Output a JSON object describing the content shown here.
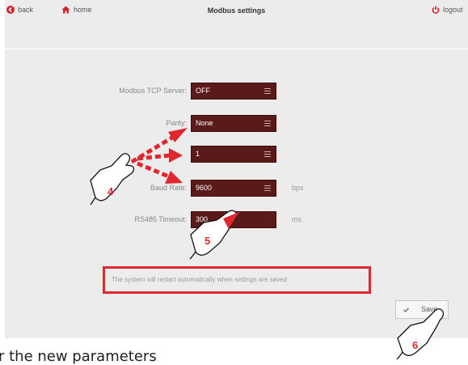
{
  "header": {
    "back_label": "back",
    "home_label": "home",
    "title": "Modbus settings",
    "logout_label": "logout"
  },
  "form": {
    "tcp_server": {
      "label": "Modbus TCP Server:",
      "value": "OFF"
    },
    "parity": {
      "label": "Parity:",
      "value": "None"
    },
    "stop_bits": {
      "value": "1"
    },
    "baud_rate": {
      "label": "Baud Rate:",
      "value": "9600",
      "unit": "bps"
    },
    "timeout": {
      "label": "RS485 Timeout:",
      "value": "300",
      "unit": "ms"
    }
  },
  "notice": "The system will restart automatically when settings are saved",
  "save_label": "Save",
  "annotations": {
    "step4": "4",
    "step5": "5",
    "step6": "6"
  },
  "caption": "r the new parameters",
  "colors": {
    "accent": "#e0262f",
    "field": "#5a1a1a",
    "panel": "#ececec"
  },
  "icons": {
    "back": "chevron-left-circle-icon",
    "home": "home-icon",
    "logout": "power-icon",
    "save": "checkmark-icon",
    "select": "menu-icon"
  }
}
